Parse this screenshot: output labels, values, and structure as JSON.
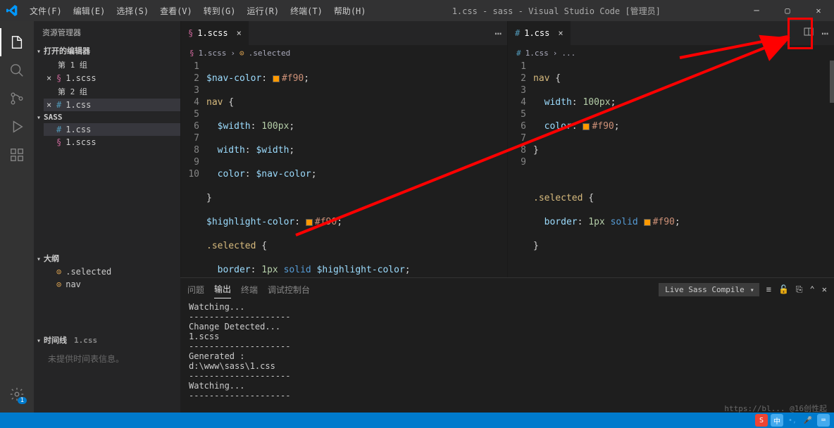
{
  "title": "1.css - sass - Visual Studio Code [管理员]",
  "menu": [
    "文件(F)",
    "编辑(E)",
    "选择(S)",
    "查看(V)",
    "转到(G)",
    "运行(R)",
    "终端(T)",
    "帮助(H)"
  ],
  "sidebar": {
    "title": "资源管理器",
    "openEditors": "打开的编辑器",
    "group1": "第 1 组",
    "group2": "第 2 组",
    "file_scss": "1.scss",
    "file_css": "1.css",
    "folderSass": "SASS",
    "outline": "大纲",
    "outline_items": [
      ".selected",
      "nav"
    ],
    "timeline": "时间线",
    "timeline_file": "1.css",
    "timeline_empty": "未提供时间表信息。"
  },
  "editor1": {
    "tab": "1.scss",
    "crumb_file": "1.scss",
    "crumb_sel": ".selected",
    "lines": [
      "1",
      "2",
      "3",
      "4",
      "5",
      "6",
      "7",
      "8",
      "9",
      "10"
    ]
  },
  "editor2": {
    "tab": "1.css",
    "crumb_file": "1.css",
    "crumb_more": "...",
    "lines": [
      "1",
      "2",
      "3",
      "4",
      "5",
      "6",
      "7",
      "8",
      "9"
    ]
  },
  "code1": {
    "l1a": "$nav-color",
    "l1b": ": ",
    "l1c": "#f90",
    "l1d": ";",
    "l2a": "nav",
    "l2b": " {",
    "l3a": "  $width",
    "l3b": ": ",
    "l3c": "100px",
    "l3d": ";",
    "l4a": "  width",
    "l4b": ": ",
    "l4c": "$width",
    "l4d": ";",
    "l5a": "  color",
    "l5b": ": ",
    "l5c": "$nav-color",
    "l5d": ";",
    "l6": "}",
    "l7a": "$highlight-color",
    "l7b": ": ",
    "l7c": "#f90",
    "l7d": ";",
    "l8a": ".selected",
    "l8b": " {",
    "l9a": "  border",
    "l9b": ": ",
    "l9c": "1px",
    "l9d": " solid ",
    "l9e": "$highlight-color",
    "l9f": ";",
    "l10": "}"
  },
  "code2": {
    "l1a": "nav",
    "l1b": " {",
    "l2a": "  width",
    "l2b": ": ",
    "l2c": "100px",
    "l2d": ";",
    "l3a": "  color",
    "l3b": ": ",
    "l3c": "#f90",
    "l3d": ";",
    "l4": "}",
    "l5": "",
    "l6a": ".selected",
    "l6b": " {",
    "l7a": "  border",
    "l7b": ": ",
    "l7c": "1px",
    "l7d": " solid ",
    "l7e": "#f90",
    "l7f": ";",
    "l8": "}"
  },
  "panel": {
    "tabs": [
      "问题",
      "输出",
      "终端",
      "调试控制台"
    ],
    "select": "Live Sass Compile",
    "output": "Watching...\n--------------------\nChange Detected...\n1.scss\n--------------------\nGenerated :\nd:\\www\\sass\\1.css\n--------------------\nWatching...\n--------------------"
  },
  "activity_badge": "1",
  "watermark": "https://bl... @16创性起"
}
